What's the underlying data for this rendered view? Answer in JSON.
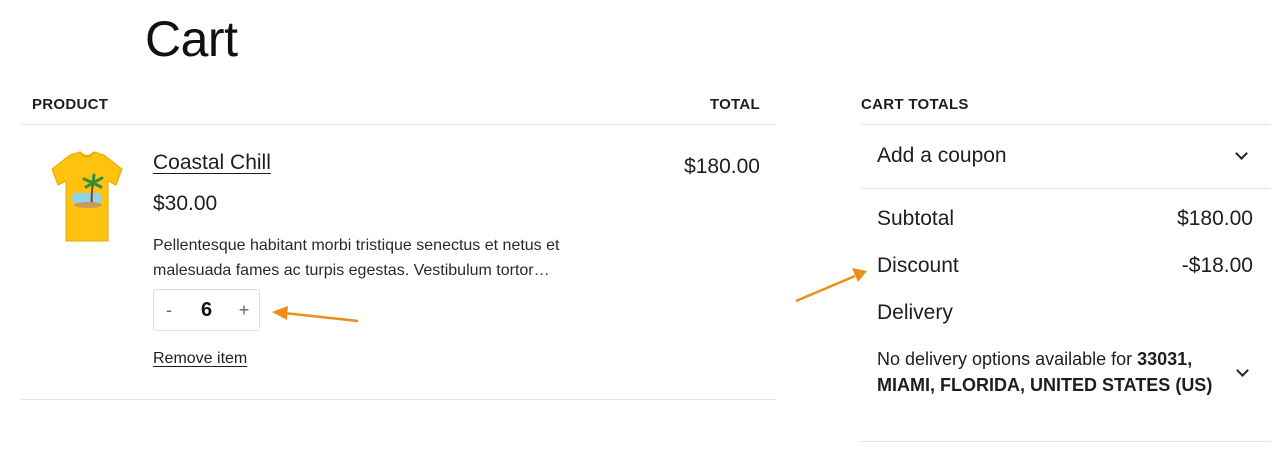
{
  "page": {
    "title": "Cart"
  },
  "cart_table": {
    "product_header": "PRODUCT",
    "total_header": "TOTAL",
    "item": {
      "name": "Coastal Chill",
      "price": "$30.00",
      "description": "Pellentesque habitant morbi tristique senectus et netus et malesuada fames ac turpis egestas. Vestibulum tortor…",
      "quantity": "6",
      "minus": "-",
      "plus": "+",
      "remove_label": "Remove item",
      "line_total": "$180.00"
    }
  },
  "totals": {
    "title": "CART TOTALS",
    "coupon_label": "Add a coupon",
    "subtotal_label": "Subtotal",
    "subtotal_value": "$180.00",
    "discount_label": "Discount",
    "discount_value": "-$18.00",
    "delivery_label": "Delivery",
    "delivery_prefix": "No delivery options available for ",
    "delivery_location": "33031, MIAMI, FLORIDA, UNITED STATES (US)"
  },
  "colors": {
    "accent_arrow": "#f08c1a",
    "shirt": "#ffc20e",
    "text": "#1e1e1e",
    "divider": "#e2e2e2"
  }
}
